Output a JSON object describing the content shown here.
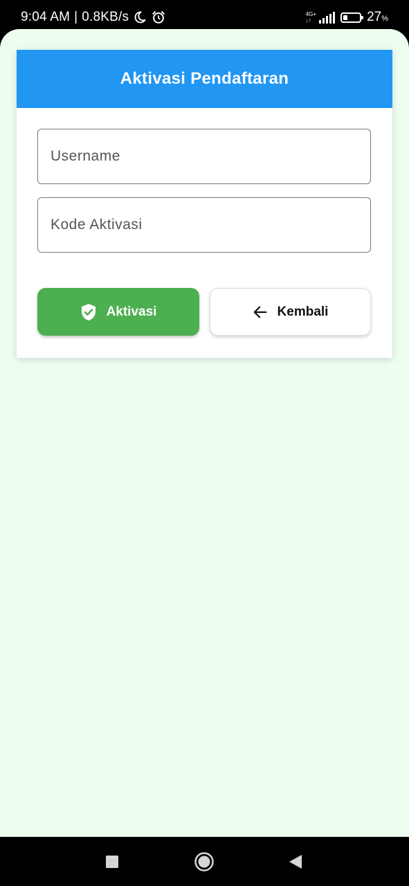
{
  "status_bar": {
    "time": "9:04 AM",
    "separator": "|",
    "net_speed": "0.8KB/s",
    "network_type_top": "4G+",
    "network_type_bottom": "↓↑",
    "battery_percent": "27",
    "battery_unit": "%",
    "battery_level": 0.27,
    "icons": [
      "moon-icon",
      "alarm-icon",
      "signal-icon",
      "battery-icon"
    ]
  },
  "form": {
    "title": "Aktivasi Pendaftaran",
    "username": {
      "placeholder": "Username",
      "value": ""
    },
    "activation_code": {
      "placeholder": "Kode Aktivasi",
      "value": ""
    },
    "activate_button": {
      "label": "Aktivasi",
      "icon": "shield-check-icon"
    },
    "back_button": {
      "label": "Kembali",
      "icon": "arrow-left-icon"
    }
  },
  "colors": {
    "header_bg": "#2196f3",
    "activate_bg": "#4caf50",
    "page_bg": "#edfdf0"
  },
  "nav_bar": {
    "icons": [
      "recent-apps-icon",
      "home-icon",
      "back-icon"
    ]
  }
}
